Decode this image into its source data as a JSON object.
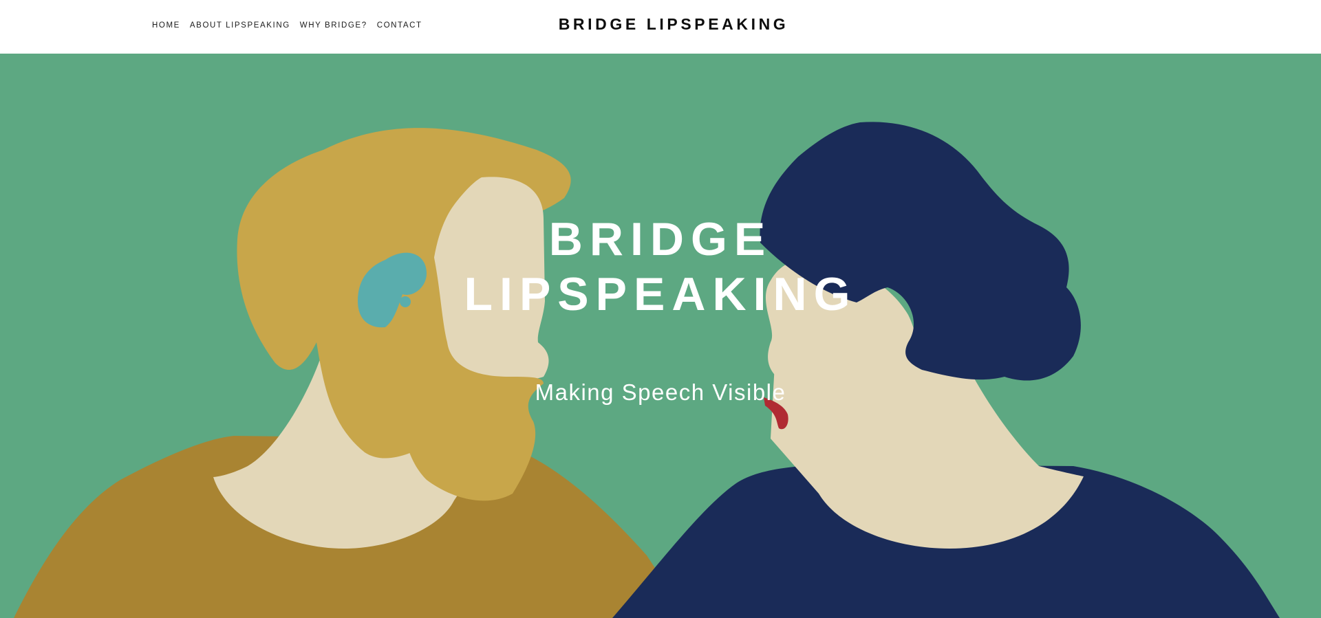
{
  "header": {
    "nav": [
      {
        "label": "HOME"
      },
      {
        "label": "ABOUT LIPSPEAKING"
      },
      {
        "label": "WHY BRIDGE?"
      },
      {
        "label": "CONTACT"
      }
    ],
    "site_title": "BRIDGE LIPSPEAKING"
  },
  "hero": {
    "heading_line1": "BRIDGE",
    "heading_line2": "LIPSPEAKING",
    "subtitle": "Making Speech Visible",
    "illustration": {
      "description_icons": [
        "man-profile-illustration",
        "woman-profile-illustration",
        "hearing-aid-icon"
      ],
      "colors": {
        "background": "#5da882",
        "man_hair": "#c8a64a",
        "man_shirt": "#a98432",
        "skin": "#e3d7b8",
        "hearing_aid": "#5aadad",
        "woman_hair": "#1a2b58",
        "woman_shirt": "#1a2b58",
        "lips": "#b02a32"
      }
    }
  }
}
